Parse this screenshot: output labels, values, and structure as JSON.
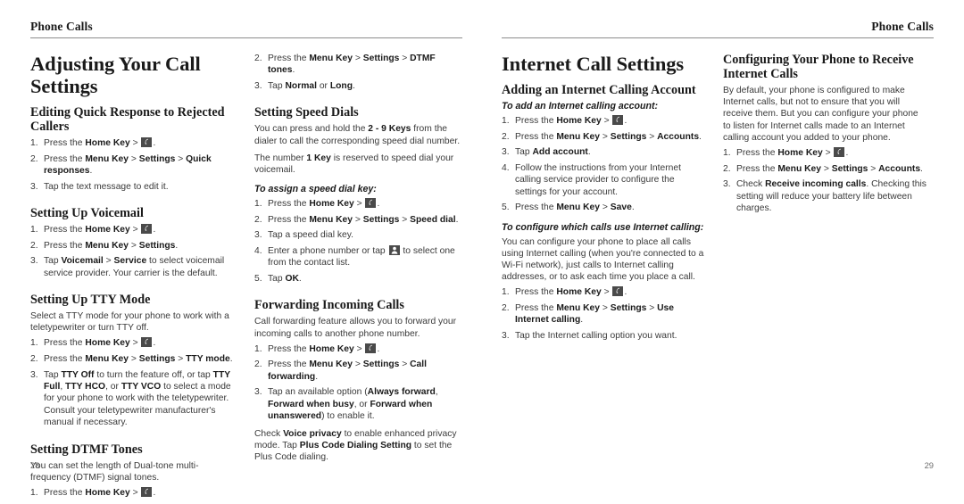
{
  "document": {
    "running_header": "Phone Calls",
    "left_page_number": "28",
    "right_page_number": "29"
  },
  "left_page": {
    "column_1": {
      "chapter_title": "Adjusting Your Call Settings",
      "sections": [
        {
          "heading": "Editing Quick Response to Rejected Callers",
          "steps": [
            "Press the Home Key > [phone-icon].",
            "Press the Menu Key > Settings > Quick responses.",
            "Tap the text message to edit it."
          ]
        },
        {
          "heading": "Setting Up Voicemail",
          "steps": [
            "Press the Home Key > [phone-icon].",
            "Press the Menu Key > Settings.",
            "Tap Voicemail > Service to select voicemail service provider. Your carrier is the default."
          ]
        },
        {
          "heading": "Setting Up TTY Mode",
          "intro": "Select a TTY mode for your phone to work with a teletypewriter or turn TTY off.",
          "steps": [
            "Press the Home Key > [phone-icon].",
            "Press the Menu Key > Settings > TTY mode.",
            "Tap TTY Off to turn the feature off, or tap TTY Full, TTY HCO, or TTY VCO to select a mode for your phone to work with the teletypewriter. Consult your teletypewriter manufacturer's manual if necessary."
          ]
        },
        {
          "heading": "Setting DTMF Tones",
          "intro": "You can set the length of Dual-tone multi-frequency (DTMF) signal tones.",
          "steps": [
            "Press the Home Key > [phone-icon]."
          ]
        }
      ]
    },
    "column_2": {
      "continued_steps": [
        "Press the Menu Key > Settings > DTMF tones.",
        "Tap Normal or Long."
      ],
      "sections": [
        {
          "heading": "Setting Speed Dials",
          "intro_1": "You can press and hold the 2 - 9 Keys from the dialer to call the corresponding speed dial number.",
          "intro_2": "The number 1 Key is reserved to speed dial your voicemail.",
          "subheading": "To assign a speed dial key:",
          "steps": [
            "Press the Home Key > [phone-icon].",
            "Press the Menu Key > Settings > Speed dial.",
            "Tap a speed dial key.",
            "Enter a phone number or tap [contact-icon] to select one from the contact list.",
            "Tap OK."
          ]
        },
        {
          "heading": "Forwarding Incoming Calls",
          "intro": "Call forwarding feature allows you to forward your incoming calls to another phone number.",
          "steps": [
            "Press the Home Key > [phone-icon].",
            "Press the Menu Key > Settings > Call forwarding.",
            "Tap an available option (Always forward, Forward when busy, or Forward when unanswered) to enable it."
          ],
          "outro": "Check Voice privacy to enable enhanced privacy mode. Tap Plus Code Dialing Setting to set the Plus Code dialing."
        }
      ]
    }
  },
  "right_page": {
    "column_1": {
      "chapter_title": "Internet Call Settings",
      "sections": [
        {
          "heading": "Adding an Internet Calling Account",
          "subheading_1": "To add an Internet calling account:",
          "steps_1": [
            "Press the Home Key > [phone-icon].",
            "Press the Menu Key > Settings > Accounts.",
            "Tap Add account.",
            "Follow the instructions from your Internet calling service provider to configure the settings for your account.",
            "Press the Menu Key > Save."
          ],
          "subheading_2": "To configure which calls use Internet calling:",
          "intro_2": "You can configure your phone to place all calls using Internet calling (when you're connected to a Wi-Fi network), just calls to Internet calling addresses, or to ask each time you place a call.",
          "steps_2": [
            "Press the Home Key > [phone-icon].",
            "Press the Menu Key > Settings > Use Internet calling.",
            "Tap the Internet calling option you want."
          ]
        }
      ]
    },
    "column_2": {
      "sections": [
        {
          "heading": "Configuring Your Phone to Receive Internet Calls",
          "intro": "By default, your phone is configured to make Internet calls, but not to ensure that you will receive them. But you can configure your phone to listen for Internet calls made to an Internet calling account you added to your phone.",
          "steps": [
            "Press the Home Key > [phone-icon].",
            "Press the Menu Key > Settings > Accounts.",
            "Check Receive incoming calls. Checking this setting will reduce your battery life between charges."
          ]
        }
      ]
    }
  },
  "text": {
    "l1_s1_step1_a": "Press the ",
    "home_key": "Home Key",
    "gt": " > ",
    "period": ".",
    "menu_key": "Menu Key",
    "settings": "Settings",
    "quick_responses": "Quick responses",
    "l1_s1_step3": "Tap the text message to edit it.",
    "voicemail": "Voicemail",
    "service": "Service",
    "l1_s2_step3_tail": " to select voicemail service provider. Your carrier is the default.",
    "tap": "Tap ",
    "tty_mode": "TTY mode",
    "tty_off": "TTY Off",
    "tty_full": "TTY Full",
    "tty_hco": "TTY HCO",
    "tty_vco": "TTY VCO",
    "l1_s3_step3_a": " to turn the feature off, or tap ",
    "l1_s3_step3_b": ", or ",
    "l1_s3_step3_c": " to select a mode for your phone to work with the teletypewriter. Consult your teletypewriter manufacturer's manual if necessary.",
    "dtmf_tones": "DTMF tones",
    "normal": "Normal",
    "long": "Long",
    "or": " or ",
    "keys_2_9": "2 - 9 Keys",
    "speed_intro_a": "You can press and hold the ",
    "speed_intro_b": " from the dialer to call the corresponding speed dial number.",
    "key_1": "1 Key",
    "speed_intro_c": "The number ",
    "speed_intro_d": " is reserved to speed dial your voicemail.",
    "speed_dial": "Speed dial",
    "tap_speed_key": "Tap a speed dial key.",
    "enter_number_a": "Enter a phone number or tap ",
    "enter_number_b": " to select one from the contact list.",
    "ok": "OK",
    "call_forwarding": "Call forwarding",
    "always_forward": "Always forward",
    "forward_busy": "Forward when busy",
    "forward_unanswered": "Forward when unanswered",
    "fwd_step3_a": "Tap an available option (",
    "fwd_step3_b": ", ",
    "fwd_step3_c": ", or ",
    "fwd_step3_d": ") to enable it.",
    "voice_privacy": "Voice privacy",
    "plus_code": "Plus Code Dialing Setting",
    "check_a": "Check ",
    "check_b": " to enable enhanced privacy mode. Tap ",
    "check_c": " to set the Plus Code dialing.",
    "accounts": "Accounts",
    "add_account": "Add account",
    "follow_instructions": "Follow the instructions from your Internet calling service provider to configure the settings for your account.",
    "save": "Save",
    "use_internet_calling": "Use Internet calling",
    "tap_internet_option": "Tap the Internet calling option you want.",
    "receive_incoming": "Receive incoming calls",
    "check_tail": ". Checking this setting will reduce your battery life between charges."
  },
  "icons": {
    "phone": "phone-handset-icon",
    "contact": "contact-person-icon"
  },
  "colors": {
    "rule": "#8c8c8c",
    "heading": "#1a1a1a",
    "body": "#3a3a3a",
    "folio": "#6d6d6d",
    "icon_background": "#4a4a4a"
  }
}
